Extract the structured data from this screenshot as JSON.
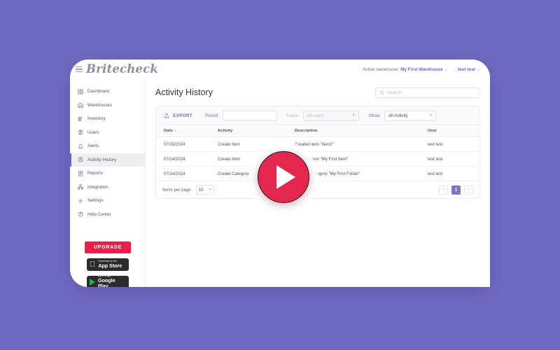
{
  "app": {
    "brand": "Britecheck",
    "menu_icon": "hamburger-icon"
  },
  "topbar": {
    "warehouse_label": "Active warehouse:",
    "warehouse_value": "My First Warehouse",
    "warehouse_caret": "⌄",
    "user": "test test",
    "user_caret": "⌄"
  },
  "sidebar": {
    "items": [
      {
        "label": "Dashboard",
        "icon": "dashboard-icon",
        "active": false
      },
      {
        "label": "Warehouses",
        "icon": "warehouse-icon",
        "active": false
      },
      {
        "label": "Inventory",
        "icon": "inventory-icon",
        "active": false
      },
      {
        "label": "Users",
        "icon": "users-icon",
        "active": false
      },
      {
        "label": "Alerts",
        "icon": "bell-icon",
        "active": false
      },
      {
        "label": "Activity History",
        "icon": "clock-history-icon",
        "active": true
      },
      {
        "label": "Reports",
        "icon": "reports-icon",
        "active": false
      },
      {
        "label": "Integration",
        "icon": "integration-icon",
        "active": false
      },
      {
        "label": "Settings",
        "icon": "gear-icon",
        "active": false
      },
      {
        "label": "Help Center",
        "icon": "help-icon",
        "active": false
      }
    ],
    "upgrade_label": "UPGRADE",
    "app_store": {
      "top": "Download on the",
      "main": "App Store",
      "icon": "apple-icon"
    },
    "google_play": {
      "top": "GET IT ON",
      "main": "Google Play",
      "icon": "google-play-icon"
    }
  },
  "main": {
    "page_title": "Activity History",
    "search": {
      "placeholder": "Search",
      "value": "",
      "icon": "search-icon"
    }
  },
  "toolbar": {
    "export_label": "EXPORT",
    "export_icon": "export-icon",
    "period_label": "Period:",
    "period_value": "",
    "users_label": "Users:",
    "users_value": "All users",
    "show_label": "Show:",
    "show_value": "All Activity",
    "caret": "▾"
  },
  "table": {
    "columns": [
      "Date",
      "Activity",
      "Description",
      "User"
    ],
    "sort_column": "Date",
    "sort_arrow": "↓",
    "rows": [
      {
        "date": "07/15/2024",
        "activity": "Create Item",
        "description": "Created item \"item2\"",
        "user": "test test"
      },
      {
        "date": "07/14/2024",
        "activity": "Create Item",
        "description": "Created item \"My First Item\"",
        "user": "test test"
      },
      {
        "date": "07/14/2024",
        "activity": "Create Category",
        "description": "Created category \"My First Folder\"",
        "user": "test test"
      }
    ]
  },
  "pagination": {
    "items_per_page_label": "Items per page",
    "items_per_page_value": "10",
    "caret": "▾",
    "prev": "‹",
    "next": "›",
    "current_page": "1"
  },
  "overlay": {
    "play_icon": "play-icon"
  },
  "colors": {
    "background": "#7069c0",
    "accent": "#6d66c4",
    "upgrade": "#ed1c4b",
    "play_button": "#e3274f",
    "page_active": "#7d76cb"
  }
}
